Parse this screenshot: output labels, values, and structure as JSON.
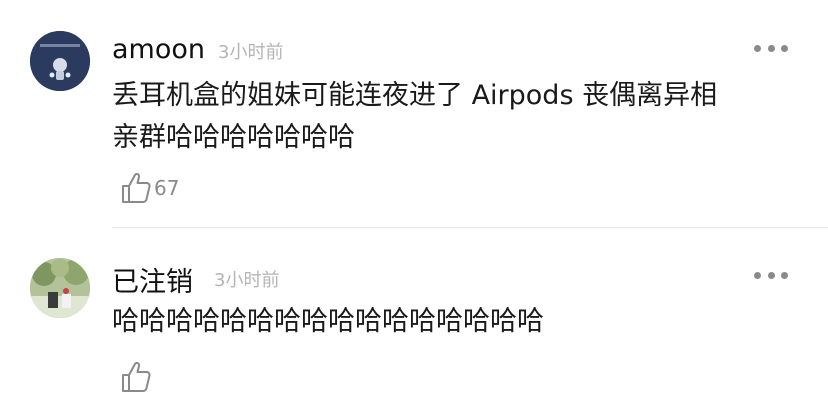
{
  "comments": [
    {
      "username": "amoon",
      "time": "3小时前",
      "lines": [
        "丢耳机盒的姐妹可能连夜进了 Airpods 丧偶离异相",
        "亲群哈哈哈哈哈哈哈"
      ],
      "likes": "67",
      "avatar_colors": {
        "bg": "#2d3e63",
        "accent": "#cfd6e6"
      }
    },
    {
      "username": "已注销",
      "time": "3小时前",
      "lines": [
        "哈哈哈哈哈哈哈哈哈哈哈哈哈哈哈哈"
      ],
      "likes": "",
      "avatar_colors": {
        "bg": "#9fb07a",
        "accent": "#e9efe0"
      }
    }
  ],
  "icons": {
    "more": "more-options-icon",
    "like": "thumbs-up-icon"
  },
  "colors": {
    "text": "#1a1a1a",
    "meta": "#b5b5b5",
    "icon": "#8a8a8a",
    "divider": "#e6e6e6"
  }
}
